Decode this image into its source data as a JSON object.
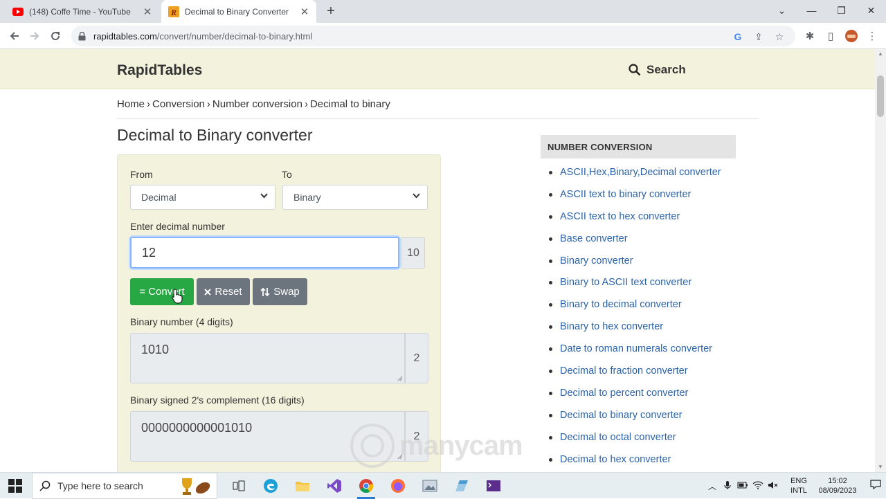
{
  "browser": {
    "tabs": [
      {
        "title": "(148) Coffe Time - YouTube",
        "icon": "youtube-icon"
      },
      {
        "title": "Decimal to Binary Converter",
        "icon": "rapidtables-icon"
      }
    ],
    "url_host": "rapidtables.com",
    "url_path": "/convert/number/decimal-to-binary.html"
  },
  "header": {
    "logo": "RapidTables",
    "search_label": "Search"
  },
  "breadcrumb": [
    "Home",
    "Conversion",
    "Number conversion",
    "Decimal to binary"
  ],
  "page_title": "Decimal to Binary converter",
  "converter": {
    "from_label": "From",
    "from_value": "Decimal",
    "to_label": "To",
    "to_value": "Binary",
    "input_label": "Enter decimal number",
    "input_value": "12",
    "input_base": "10",
    "convert_label": "= Convert",
    "reset_label": "Reset",
    "swap_label": "Swap",
    "output1_label": "Binary number (4 digits)",
    "output1_value": "1010",
    "output1_base": "2",
    "output2_label": "Binary signed 2's complement (16 digits)",
    "output2_value": "0000000000001010",
    "output2_base": "2"
  },
  "sidebar": {
    "heading": "NUMBER CONVERSION",
    "items": [
      "ASCII,Hex,Binary,Decimal converter",
      "ASCII text to binary converter",
      "ASCII text to hex converter",
      "Base converter",
      "Binary converter",
      "Binary to ASCII text converter",
      "Binary to decimal converter",
      "Binary to hex converter",
      "Date to roman numerals converter",
      "Decimal to fraction converter",
      "Decimal to percent converter",
      "Decimal to binary converter",
      "Decimal to octal converter",
      "Decimal to hex converter"
    ]
  },
  "watermark": "manycam",
  "taskbar": {
    "search_placeholder": "Type here to search",
    "lang_line1": "ENG",
    "lang_line2": "INTL",
    "time": "15:02",
    "date": "08/09/2023"
  },
  "colors": {
    "header_bg": "#f3f2dc",
    "convert_button": "#28a745",
    "secondary_button": "#6c757d",
    "link": "#2a62a8"
  }
}
